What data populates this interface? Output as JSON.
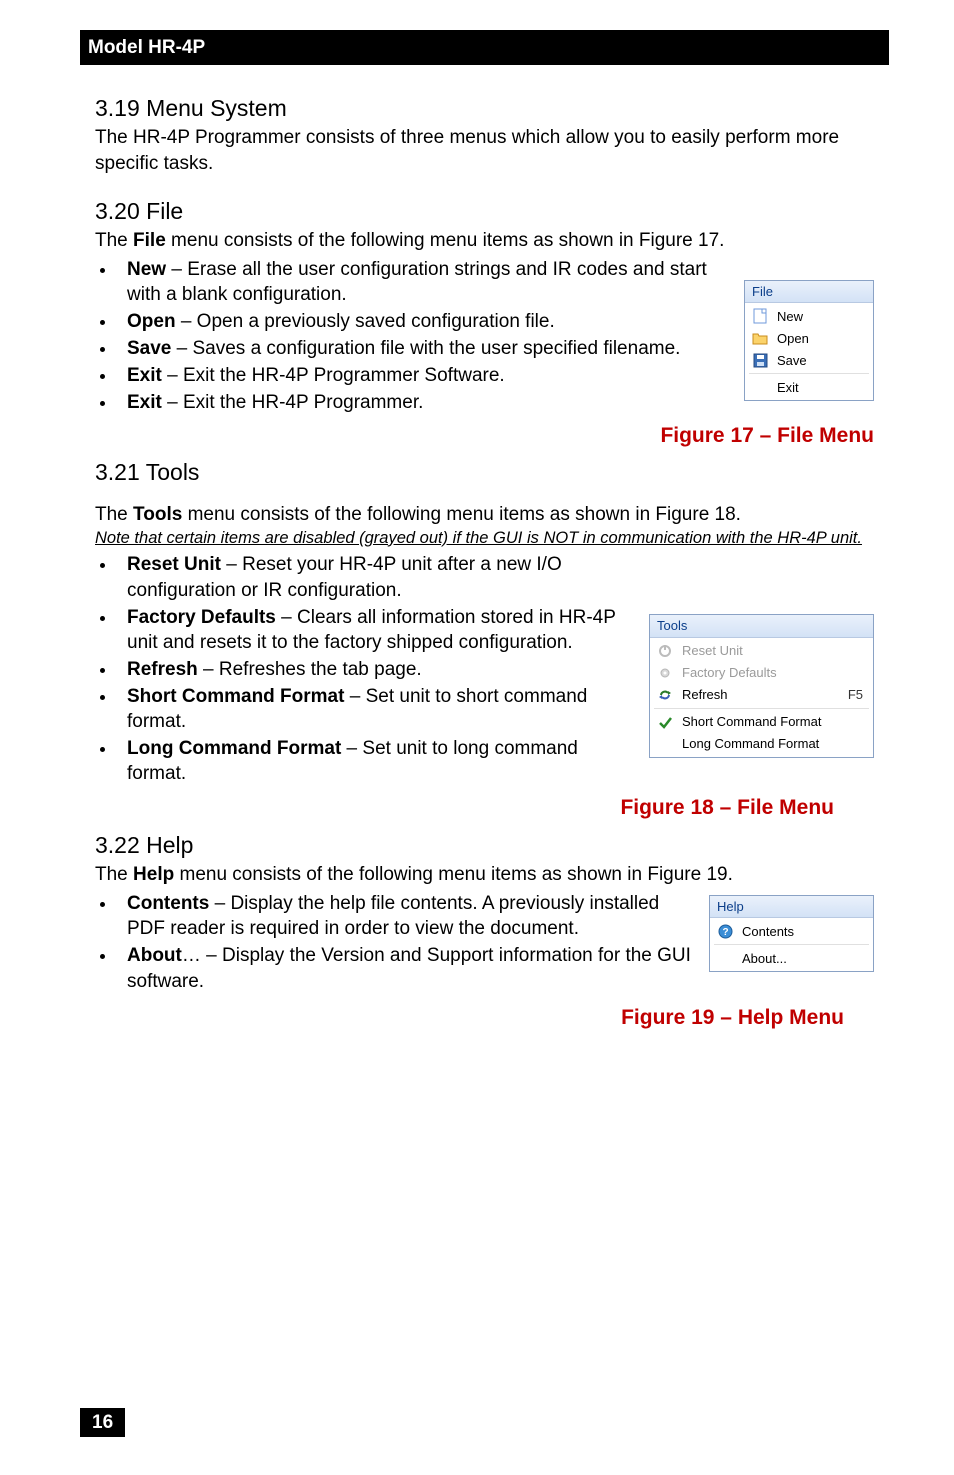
{
  "header": {
    "model": "Model HR-4P"
  },
  "sections": {
    "menuSystem": {
      "title": "3.19 Menu System",
      "intro": "The HR-4P Programmer consists of three menus which allow you to easily perform more specific tasks."
    },
    "file": {
      "title": "3.20 File",
      "intro_a": "The ",
      "intro_b": "File",
      "intro_c": " menu consists of the following menu items as shown in Figure 17.",
      "items": [
        {
          "term": "New",
          "desc": " – Erase all the user configuration strings and IR codes and start with a blank configuration."
        },
        {
          "term": "Open",
          "desc": " – Open a previously saved configuration file."
        },
        {
          "term": "Save",
          "desc": " – Saves a configuration file with the user specified filename."
        },
        {
          "term": "Exit",
          "desc": " – Exit the HR-4P Programmer Software."
        },
        {
          "term": "Exit",
          "desc": " – Exit the HR-4P Programmer."
        }
      ],
      "caption": "Figure 17 – File Menu"
    },
    "tools": {
      "title": "3.21 Tools",
      "intro_a": "The ",
      "intro_b": "Tools",
      "intro_c": " menu consists of the following menu items as shown in Figure 18.",
      "note": "Note that certain items are disabled (grayed out) if the GUI is NOT in communication with the HR-4P unit.",
      "items": [
        {
          "term": "Reset Unit",
          "desc": " – Reset your HR-4P unit after a new I/O configuration or IR configuration."
        },
        {
          "term": "Factory Defaults",
          "desc": " – Clears all information stored in HR-4P unit and resets it to the factory shipped configuration."
        },
        {
          "term": "Refresh",
          "desc": " – Refreshes the tab page."
        },
        {
          "term": "Short Command Format",
          "desc": " – Set unit to short command format."
        },
        {
          "term": "Long Command Format",
          "desc": " – Set unit to long command format."
        }
      ],
      "caption": "Figure 18 – File Menu"
    },
    "help": {
      "title": "3.22 Help",
      "intro_a": "The ",
      "intro_b": "Help",
      "intro_c": " menu consists of the following menu items as shown in Figure 19.",
      "items": [
        {
          "term": "Contents",
          "desc": " – Display the help file contents. A previously installed PDF reader is required in order to view the document."
        },
        {
          "term": "About",
          "desc": "… – Display the Version and Support information for the GUI software."
        }
      ],
      "caption": "Figure 19 – Help Menu"
    }
  },
  "menus": {
    "file": {
      "title": "File",
      "rows": [
        {
          "label": "New",
          "icon": "new-page-icon"
        },
        {
          "label": "Open",
          "icon": "open-folder-icon"
        },
        {
          "label": "Save",
          "icon": "save-disk-icon"
        },
        {
          "sep": true
        },
        {
          "label": "Exit"
        }
      ]
    },
    "tools": {
      "title": "Tools",
      "rows": [
        {
          "label": "Reset Unit",
          "icon": "reset-icon",
          "disabled": true
        },
        {
          "label": "Factory Defaults",
          "icon": "gear-icon",
          "disabled": true
        },
        {
          "label": "Refresh",
          "icon": "refresh-arrows-icon",
          "shortcut": "F5"
        },
        {
          "sep": true
        },
        {
          "label": "Short Command Format",
          "icon": "check-icon"
        },
        {
          "label": "Long Command Format"
        }
      ]
    },
    "help": {
      "title": "Help",
      "rows": [
        {
          "label": "Contents",
          "icon": "help-icon"
        },
        {
          "sep": true
        },
        {
          "label": "About..."
        }
      ]
    }
  },
  "page": {
    "number": "16"
  }
}
